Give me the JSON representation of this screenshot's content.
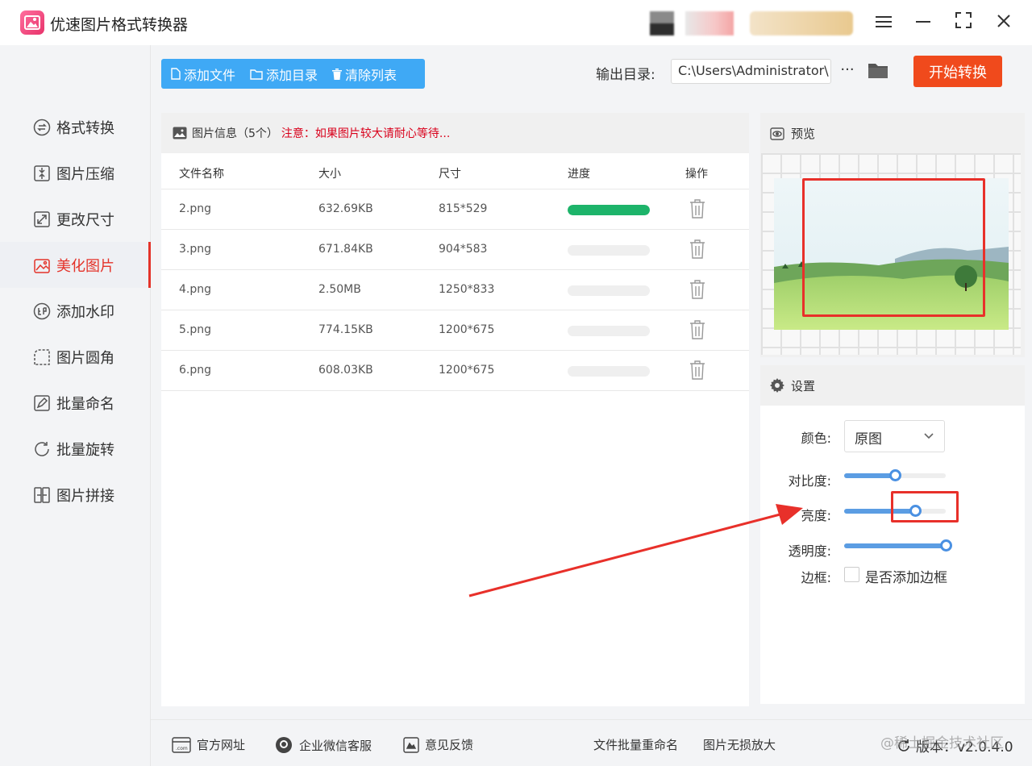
{
  "app": {
    "title": "优速图片格式转换器"
  },
  "sidebar": {
    "items": [
      {
        "label": "格式转换",
        "icon": "format-convert-icon",
        "active": false
      },
      {
        "label": "图片压缩",
        "icon": "compress-icon",
        "active": false
      },
      {
        "label": "更改尺寸",
        "icon": "resize-icon",
        "active": false
      },
      {
        "label": "美化图片",
        "icon": "beautify-icon",
        "active": true
      },
      {
        "label": "添加水印",
        "icon": "watermark-icon",
        "active": false
      },
      {
        "label": "图片圆角",
        "icon": "rounded-corner-icon",
        "active": false
      },
      {
        "label": "批量命名",
        "icon": "rename-icon",
        "active": false
      },
      {
        "label": "批量旋转",
        "icon": "rotate-icon",
        "active": false
      },
      {
        "label": "图片拼接",
        "icon": "stitch-icon",
        "active": false
      }
    ]
  },
  "toolbar": {
    "add_file": "添加文件",
    "add_dir": "添加目录",
    "clear_list": "清除列表",
    "output_label": "输出目录:",
    "output_path": "C:\\Users\\Administrator\\",
    "more": "···",
    "start": "开始转换"
  },
  "file_panel": {
    "header": "图片信息（5个）",
    "warning": "注意：如果图片较大请耐心等待...",
    "columns": [
      "文件名称",
      "大小",
      "尺寸",
      "进度",
      "操作"
    ],
    "rows": [
      {
        "name": "2.png",
        "size": "632.69KB",
        "dims": "815*529",
        "progress": 1.0
      },
      {
        "name": "3.png",
        "size": "671.84KB",
        "dims": "904*583",
        "progress": 0.0
      },
      {
        "name": "4.png",
        "size": "2.50MB",
        "dims": "1250*833",
        "progress": 0.0
      },
      {
        "name": "5.png",
        "size": "774.15KB",
        "dims": "1200*675",
        "progress": 0.0
      },
      {
        "name": "6.png",
        "size": "608.03KB",
        "dims": "1200*675",
        "progress": 0.0
      }
    ]
  },
  "preview": {
    "title": "预览"
  },
  "settings": {
    "title": "设置",
    "color_label": "颜色:",
    "color_value": "原图",
    "contrast_label": "对比度:",
    "contrast_value": 0.5,
    "brightness_label": "亮度:",
    "brightness_value": 0.7,
    "opacity_label": "透明度:",
    "opacity_value": 1.0,
    "border_label": "边框:",
    "border_checkbox": "是否添加边框",
    "border_checked": false
  },
  "bottom": {
    "website": "官方网址",
    "wechat": "企业微信客服",
    "feedback": "意见反馈",
    "batch_rename": "文件批量重命名",
    "lossless": "图片无损放大",
    "version": "版本：v2.0.4.0",
    "watermark": "@稀土掘金技术社区"
  },
  "colors": {
    "accent": "#3fa9f5",
    "start": "#f04a1c",
    "active": "#e4332a",
    "progress": "#1db46a",
    "slider": "#4a90e2"
  }
}
